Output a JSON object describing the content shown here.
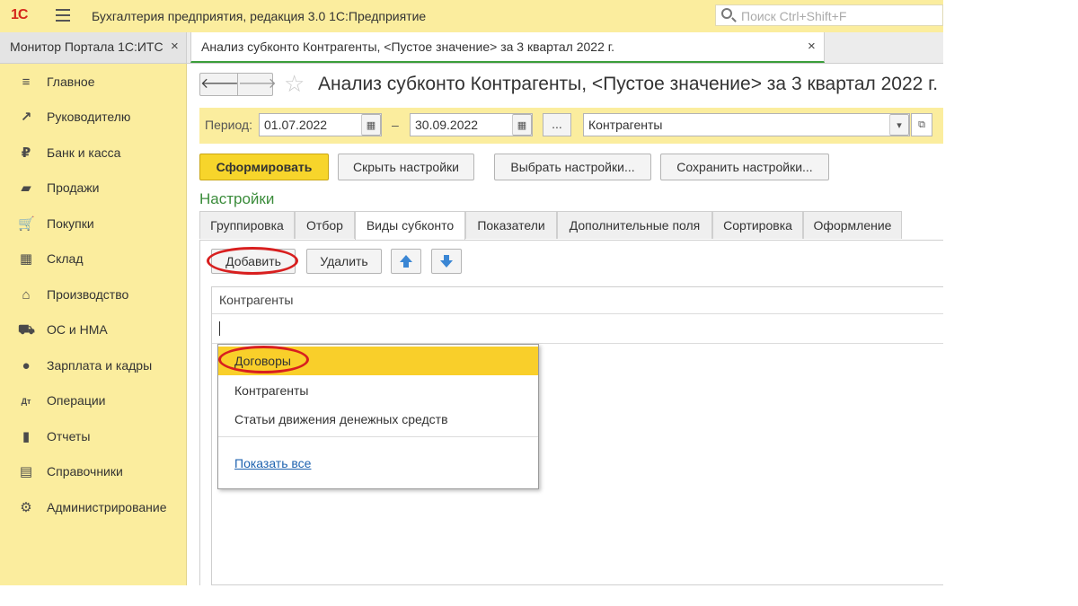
{
  "titlebar": {
    "logo": "1С",
    "app_title": "Бухгалтерия предприятия, редакция 3.0 1С:Предприятие",
    "search_placeholder": "Поиск Ctrl+Shift+F"
  },
  "tabs": [
    {
      "label": "Монитор Портала 1С:ИТС",
      "close": "×"
    },
    {
      "label": "Анализ субконто Контрагенты, <Пустое значение> за 3 квартал 2022 г.",
      "close": "×"
    }
  ],
  "sidebar": {
    "items": [
      {
        "label": "Главное",
        "icon": "≡"
      },
      {
        "label": "Руководителю",
        "icon": "↗"
      },
      {
        "label": "Банк и касса",
        "icon": "₽"
      },
      {
        "label": "Продажи",
        "icon": "▰"
      },
      {
        "label": "Покупки",
        "icon": "🛒"
      },
      {
        "label": "Склад",
        "icon": "▦"
      },
      {
        "label": "Производство",
        "icon": "⌂"
      },
      {
        "label": "ОС и НМА",
        "icon": "⛟"
      },
      {
        "label": "Зарплата и кадры",
        "icon": "●"
      },
      {
        "label": "Операции",
        "icon": "Дт"
      },
      {
        "label": "Отчеты",
        "icon": "▮"
      },
      {
        "label": "Справочники",
        "icon": "▤"
      },
      {
        "label": "Администрирование",
        "icon": "⚙"
      }
    ]
  },
  "nav": {
    "back": "🡐",
    "forward": "🡒",
    "star": "☆"
  },
  "page": {
    "title": "Анализ субконто Контрагенты, <Пустое значение> за 3 квартал 2022 г."
  },
  "period": {
    "label": "Период:",
    "from": "01.07.2022",
    "dash": "–",
    "to": "30.09.2022",
    "dots": "...",
    "subconto": "Контрагенты"
  },
  "toolbar": {
    "generate": "Сформировать",
    "hide_settings": "Скрыть настройки",
    "choose_settings": "Выбрать настройки...",
    "save_settings": "Сохранить настройки..."
  },
  "settings": {
    "title": "Настройки",
    "tabs": [
      "Группировка",
      "Отбор",
      "Виды субконто",
      "Показатели",
      "Дополнительные поля",
      "Сортировка",
      "Оформление"
    ],
    "active_tab": "Виды субконто",
    "add": "Добавить",
    "delete": "Удалить"
  },
  "grid": {
    "header": "Контрагенты"
  },
  "dropdown": {
    "items": [
      "Договоры",
      "Контрагенты",
      "Статьи движения денежных средств"
    ],
    "selected": "Договоры",
    "show_all": "Показать все"
  },
  "colors": {
    "accent_yellow": "#fbed9e",
    "primary_button": "#f7d52b",
    "selected_item": "#f9cf2a",
    "annotation_red": "#d81f1f",
    "settings_green": "#3b8c3b",
    "link_blue": "#1f63b0"
  }
}
